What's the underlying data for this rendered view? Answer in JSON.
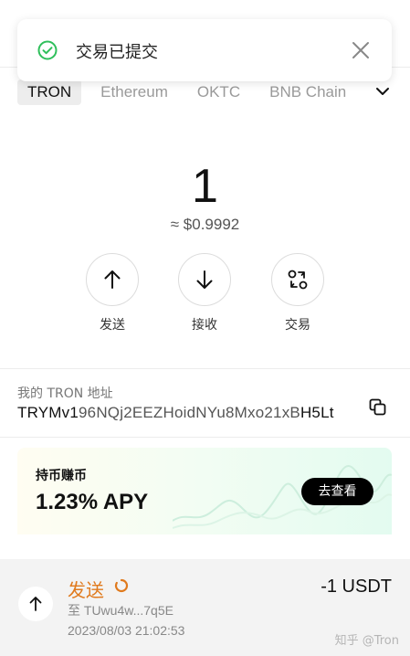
{
  "toast": {
    "message": "交易已提交",
    "check_icon": "check-circle-icon",
    "close_icon": "close-icon",
    "accent": "#2fbf5b"
  },
  "networks": {
    "tabs": [
      {
        "label": "TRON",
        "active": true
      },
      {
        "label": "Ethereum",
        "active": false
      },
      {
        "label": "OKTC",
        "active": false
      },
      {
        "label": "BNB Chain",
        "active": false
      }
    ],
    "more_icon": "chevron-down-icon"
  },
  "balance": {
    "amount": "1",
    "fiat": "≈ $0.9992"
  },
  "actions": [
    {
      "label": "发送",
      "icon": "arrow-up-icon"
    },
    {
      "label": "接收",
      "icon": "arrow-down-icon"
    },
    {
      "label": "交易",
      "icon": "swap-icon"
    }
  ],
  "address": {
    "label": "我的 TRON 地址",
    "prefix": "TRYMv1",
    "middle": "96NQj2EEZHoidNYu8Mxo21xB",
    "suffix": "H5Lt",
    "copy_icon": "copy-icon"
  },
  "earn": {
    "title": "持币赚币",
    "apy": "1.23% APY",
    "button": "去查看"
  },
  "transaction": {
    "type": "发送",
    "status_icon": "pending-spinner-icon",
    "to_prefix": "至",
    "to_address": "TUwu4w...7q5E",
    "time": "2023/08/03 21:02:53",
    "amount": "-1 USDT",
    "direction_icon": "arrow-up-icon",
    "status_color": "#e07a1d"
  },
  "watermark": "知乎 @Tron"
}
